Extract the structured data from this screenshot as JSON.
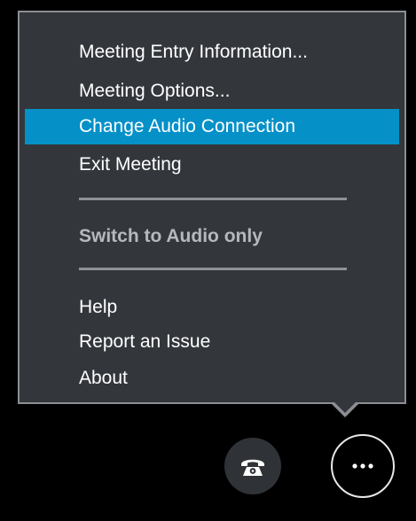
{
  "menu": {
    "items": [
      {
        "label": "Meeting Entry Information..."
      },
      {
        "label": "Meeting Options..."
      },
      {
        "label": "Change Audio Connection",
        "highlighted": true
      },
      {
        "label": "Exit Meeting"
      },
      {
        "label": "Switch to Audio only",
        "disabled": true
      },
      {
        "label": "Help"
      },
      {
        "label": "Report an Issue"
      },
      {
        "label": "About"
      }
    ]
  },
  "buttons": {
    "phone": {
      "icon": "phone-icon"
    },
    "more": {
      "icon": "more-options-icon"
    }
  },
  "colors": {
    "menu_background": "#33373c",
    "menu_border": "#8b8f93",
    "highlight": "#0590c8",
    "disabled_text": "#b6b9bc",
    "page_background": "#000000"
  }
}
